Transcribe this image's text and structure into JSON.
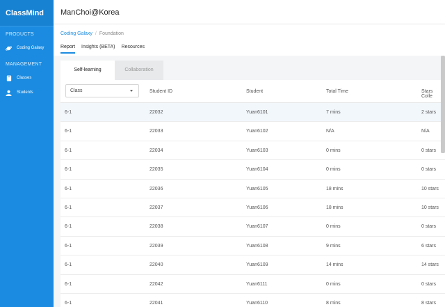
{
  "sidebar": {
    "brand": "ClassMind",
    "sections": [
      {
        "label": "PRODUCTS"
      },
      {
        "label": "MANAGEMENT"
      }
    ],
    "items": [
      {
        "label": "Coding Galaxy",
        "icon": "planet-icon"
      },
      {
        "label": "Classes",
        "icon": "book-icon"
      },
      {
        "label": "Students",
        "icon": "person-icon"
      }
    ]
  },
  "header": {
    "account": "ManChoi@Korea"
  },
  "breadcrumb": {
    "product": "Coding Galaxy",
    "current": "Foundation"
  },
  "tabs": [
    "Report",
    "Insights (BETA)",
    "Resources"
  ],
  "subtabs": [
    "Self-learning",
    "Collaboration"
  ],
  "table": {
    "class_filter": "Class",
    "headers": [
      "Student ID",
      "Student",
      "Total Time",
      "Stars Colle"
    ],
    "rows": [
      [
        "6-1",
        "22032",
        "Yuan6101",
        "7 mins",
        "2 stars"
      ],
      [
        "6-1",
        "22033",
        "Yuan6102",
        "N/A",
        "N/A"
      ],
      [
        "6-1",
        "22034",
        "Yuan6103",
        "0 mins",
        "0 stars"
      ],
      [
        "6-1",
        "22035",
        "Yuan6104",
        "0 mins",
        "0 stars"
      ],
      [
        "6-1",
        "22036",
        "Yuan6105",
        "18 mins",
        "10 stars"
      ],
      [
        "6-1",
        "22037",
        "Yuan6106",
        "18 mins",
        "10 stars"
      ],
      [
        "6-1",
        "22038",
        "Yuan6107",
        "0 mins",
        "0 stars"
      ],
      [
        "6-1",
        "22039",
        "Yuan6108",
        "9 mins",
        "6 stars"
      ],
      [
        "6-1",
        "22040",
        "Yuan6109",
        "14 mins",
        "14 stars"
      ],
      [
        "6-1",
        "22042",
        "Yuan6111",
        "0 mins",
        "0 stars"
      ],
      [
        "6-1",
        "22041",
        "Yuan6110",
        "8 mins",
        "8 stars"
      ]
    ]
  },
  "colors": {
    "accent": "#1a8be0",
    "sidebar": "#1a8be0",
    "row_highlight": "#f2f7fc"
  }
}
